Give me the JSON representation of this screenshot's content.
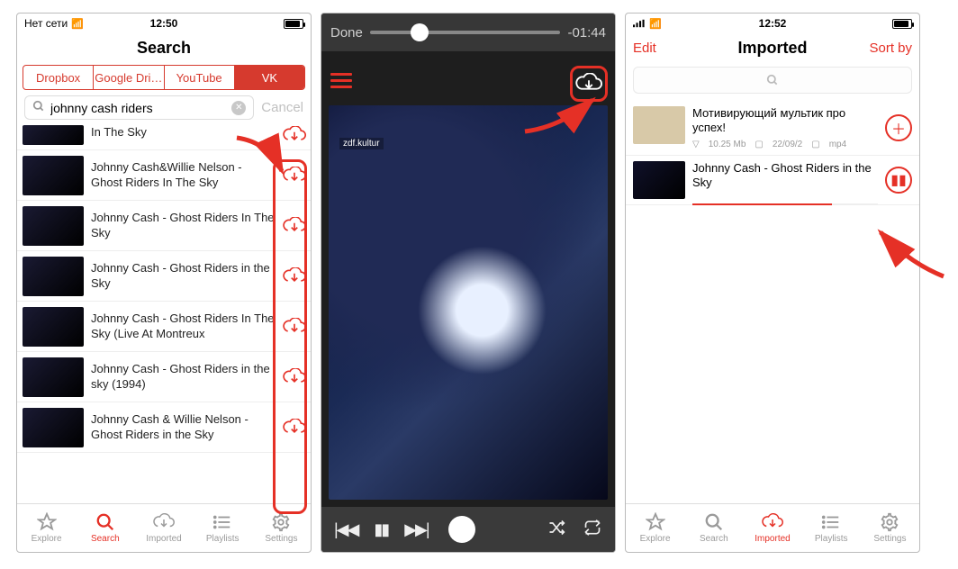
{
  "screen1": {
    "status": {
      "network": "Нет сети",
      "time": "12:50"
    },
    "title": "Search",
    "source_tabs": [
      "Dropbox",
      "Google Dri…",
      "YouTube",
      "VK"
    ],
    "active_tab": 3,
    "query": "johnny cash riders",
    "cancel": "Cancel",
    "results": [
      {
        "title": "Johnny Cash - Ghost Riders In The Sky"
      },
      {
        "title": "Johnny Cash&Willie Nelson - Ghost Riders In The Sky"
      },
      {
        "title": "Johnny Cash - Ghost Riders In The Sky"
      },
      {
        "title": "Johnny Cash - Ghost Riders in the Sky"
      },
      {
        "title": "Johnny Cash - Ghost Riders In The Sky (Live At Montreux"
      },
      {
        "title": "Johnny Cash - Ghost Riders in the sky (1994)"
      },
      {
        "title": "Johnny Cash & Willie Nelson - Ghost Riders in the Sky"
      }
    ]
  },
  "screen2": {
    "done": "Done",
    "time_remaining": "-01:44",
    "art_tag": "zdf.kultur"
  },
  "screen3": {
    "status": {
      "time": "12:52"
    },
    "edit": "Edit",
    "title": "Imported",
    "sort": "Sort by",
    "items": [
      {
        "title": "Мотивирующий мультик про успех!",
        "size": "10.25 Mb",
        "date": "22/09/2",
        "format": "mp4",
        "action": "add"
      },
      {
        "title": "Johnny Cash - Ghost Riders in the Sky",
        "action": "pause",
        "progress": 0.75
      }
    ]
  },
  "tabbar": {
    "items": [
      "Explore",
      "Search",
      "Imported",
      "Playlists",
      "Settings"
    ]
  },
  "colors": {
    "accent": "#e53026",
    "brand_red": "#d63a2e"
  }
}
